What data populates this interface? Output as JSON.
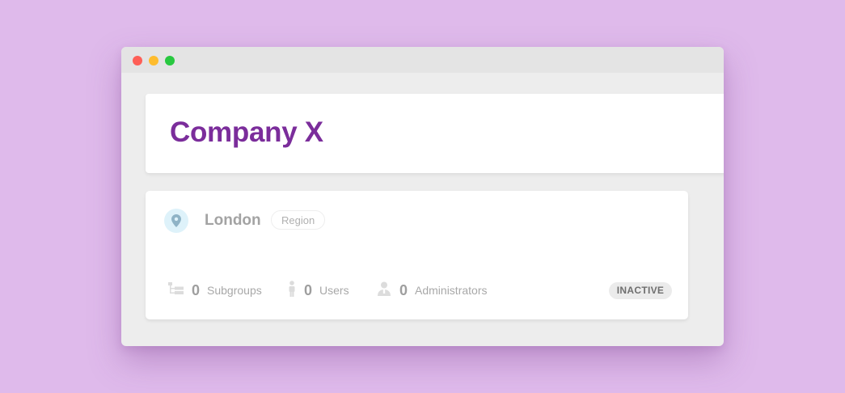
{
  "header": {
    "title": "Company X"
  },
  "group": {
    "name": "London",
    "type": "Region",
    "status": "INACTIVE",
    "stats": {
      "subgroups": {
        "count": "0",
        "label": "Subgroups",
        "icon": "hierarchy-icon"
      },
      "users": {
        "count": "0",
        "label": "Users",
        "icon": "person-icon"
      },
      "administrators": {
        "count": "0",
        "label": "Administrators",
        "icon": "admin-user-icon"
      }
    },
    "icon": "location-pin-icon"
  },
  "colors": {
    "background": "#dfbaeb",
    "title": "#7b2d9b",
    "pin_bg": "#def2fa",
    "pin": "#8fb3c6",
    "status_bg": "#ebebeb",
    "status_text": "#6f6f6f"
  }
}
